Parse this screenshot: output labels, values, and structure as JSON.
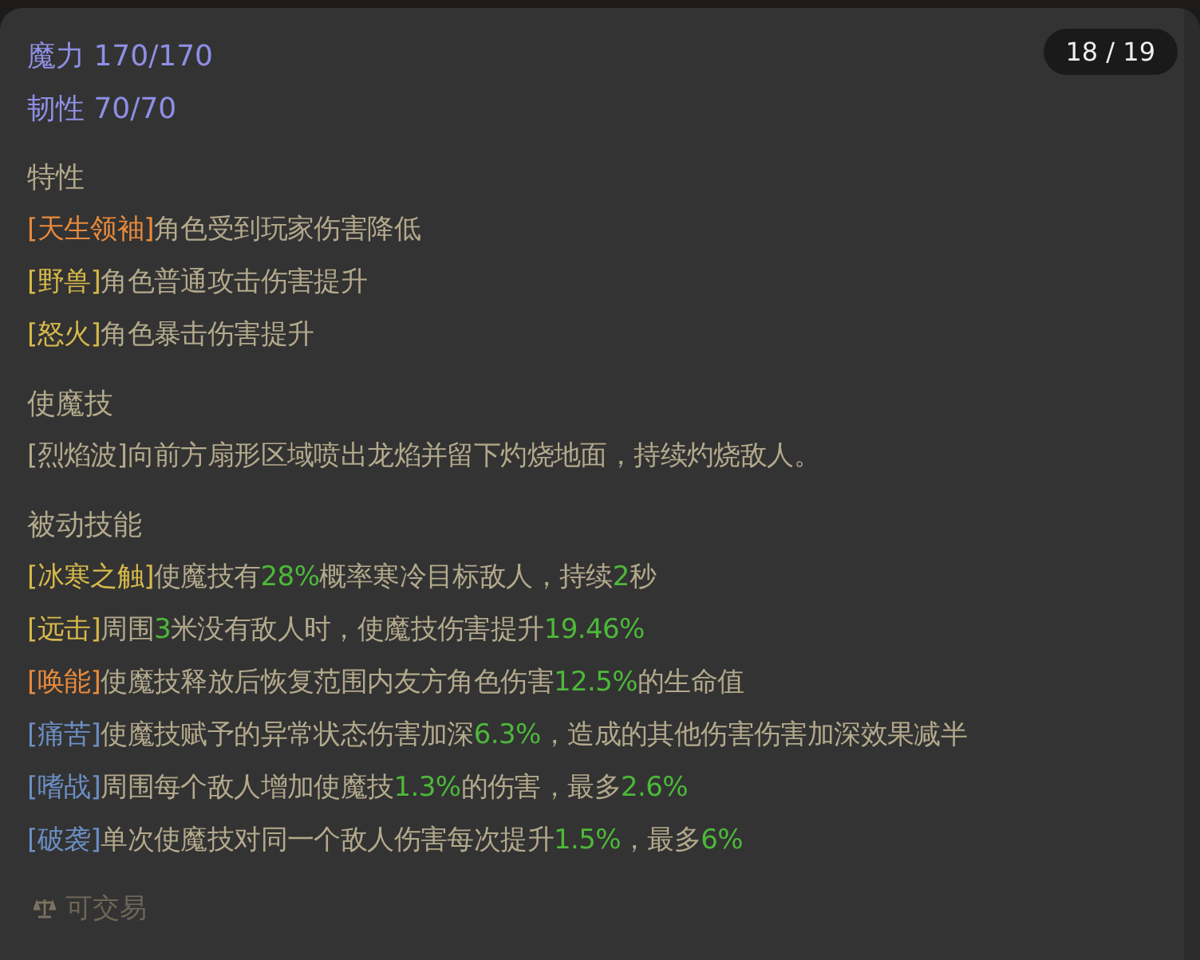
{
  "badge": "18 / 19",
  "stats": [
    {
      "text": "魔力 170/170"
    },
    {
      "text": "韧性 70/70"
    }
  ],
  "sections": [
    {
      "title": "特性",
      "entries": [
        {
          "tag": "[天生领袖]",
          "color": "#e88a3c",
          "parts": [
            {
              "text": "角色受到玩家伤害降低",
              "highlight": false
            }
          ]
        },
        {
          "tag": "[野兽]",
          "color": "#d6b84a",
          "parts": [
            {
              "text": "角色普通攻击伤害提升",
              "highlight": false
            }
          ]
        },
        {
          "tag": "[怒火]",
          "color": "#d6b84a",
          "parts": [
            {
              "text": "角色暴击伤害提升",
              "highlight": false
            }
          ]
        }
      ]
    },
    {
      "title": "使魔技",
      "entries": [
        {
          "tag": "[烈焰波]",
          "color": "#b3a98c",
          "parts": [
            {
              "text": "向前方扇形区域喷出龙焰并留下灼烧地面，持续灼烧敌人。",
              "highlight": false
            }
          ]
        }
      ]
    },
    {
      "title": "被动技能",
      "entries": [
        {
          "tag": "[冰寒之触]",
          "color": "#d6b84a",
          "parts": [
            {
              "text": "使魔技有",
              "highlight": false
            },
            {
              "text": "28%",
              "highlight": true
            },
            {
              "text": "概率寒冷目标敌人，持续",
              "highlight": false
            },
            {
              "text": "2",
              "highlight": true
            },
            {
              "text": "秒",
              "highlight": false
            }
          ]
        },
        {
          "tag": "[远击]",
          "color": "#d6b84a",
          "parts": [
            {
              "text": "周围",
              "highlight": false
            },
            {
              "text": "3",
              "highlight": true
            },
            {
              "text": "米没有敌人时，使魔技伤害提升",
              "highlight": false
            },
            {
              "text": "19.46%",
              "highlight": true
            }
          ]
        },
        {
          "tag": "[唤能]",
          "color": "#e88a3c",
          "parts": [
            {
              "text": "使魔技释放后恢复范围内友方角色伤害",
              "highlight": false
            },
            {
              "text": "12.5%",
              "highlight": true
            },
            {
              "text": "的生命值",
              "highlight": false
            }
          ]
        },
        {
          "tag": "[痛苦]",
          "color": "#6c8ec4",
          "parts": [
            {
              "text": "使魔技赋予的异常状态伤害加深",
              "highlight": false
            },
            {
              "text": "6.3%",
              "highlight": true
            },
            {
              "text": "，造成的其他伤害伤害加深效果减半",
              "highlight": false
            }
          ]
        },
        {
          "tag": "[嗜战]",
          "color": "#6c8ec4",
          "parts": [
            {
              "text": "周围每个敌人增加使魔技",
              "highlight": false
            },
            {
              "text": "1.3%",
              "highlight": true
            },
            {
              "text": "的伤害，最多",
              "highlight": false
            },
            {
              "text": "2.6%",
              "highlight": true
            }
          ]
        },
        {
          "tag": "[破袭]",
          "color": "#6c8ec4",
          "parts": [
            {
              "text": "单次使魔技对同一个敌人伤害每次提升",
              "highlight": false
            },
            {
              "text": "1.5%",
              "highlight": true
            },
            {
              "text": "，最多",
              "highlight": false
            },
            {
              "text": "6%",
              "highlight": true
            }
          ]
        }
      ]
    }
  ],
  "footer": {
    "label": "可交易"
  }
}
